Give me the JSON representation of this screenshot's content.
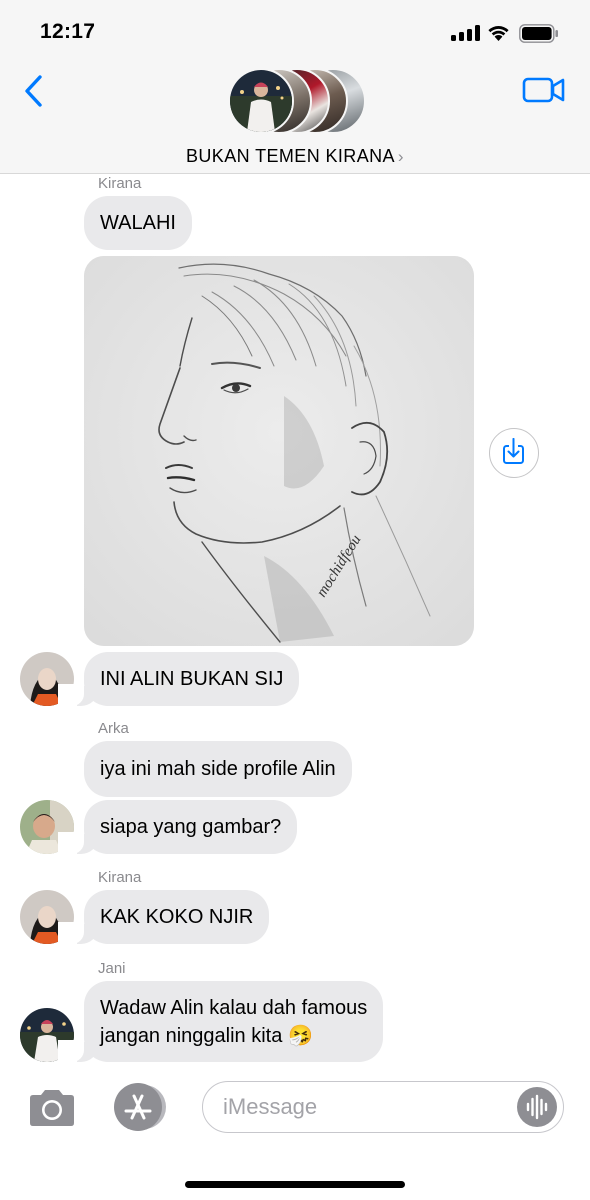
{
  "status_bar": {
    "time": "12:17"
  },
  "header": {
    "group_name": "BUKAN TEMEN KIRANA",
    "chevron": "›"
  },
  "messages": [
    {
      "sender": "Kirana",
      "text": "WALAHI"
    },
    {
      "image": "pencil-sketch-side-profile",
      "signature": "mochidfeou"
    },
    {
      "text": "INI ALIN BUKAN SIJ"
    },
    {
      "sender": "Arka",
      "text": "iya ini mah side profile Alin"
    },
    {
      "text": "siapa yang gambar?"
    },
    {
      "sender": "Kirana",
      "text": "KAK KOKO NJIR"
    },
    {
      "sender": "Jani",
      "line1": "Wadaw Alin kalau dah famous",
      "line2": "jangan ninggalin kita",
      "emoji": "🤧"
    }
  ],
  "input": {
    "placeholder": "iMessage"
  },
  "icons": [
    "back-chevron-icon",
    "video-camera-icon",
    "save-to-photos-icon",
    "camera-icon",
    "app-store-icon",
    "audio-waveform-icon"
  ],
  "colors": {
    "accent": "#007aff",
    "bubble": "#e9e9eb",
    "sender_label": "#8a8a8e"
  }
}
